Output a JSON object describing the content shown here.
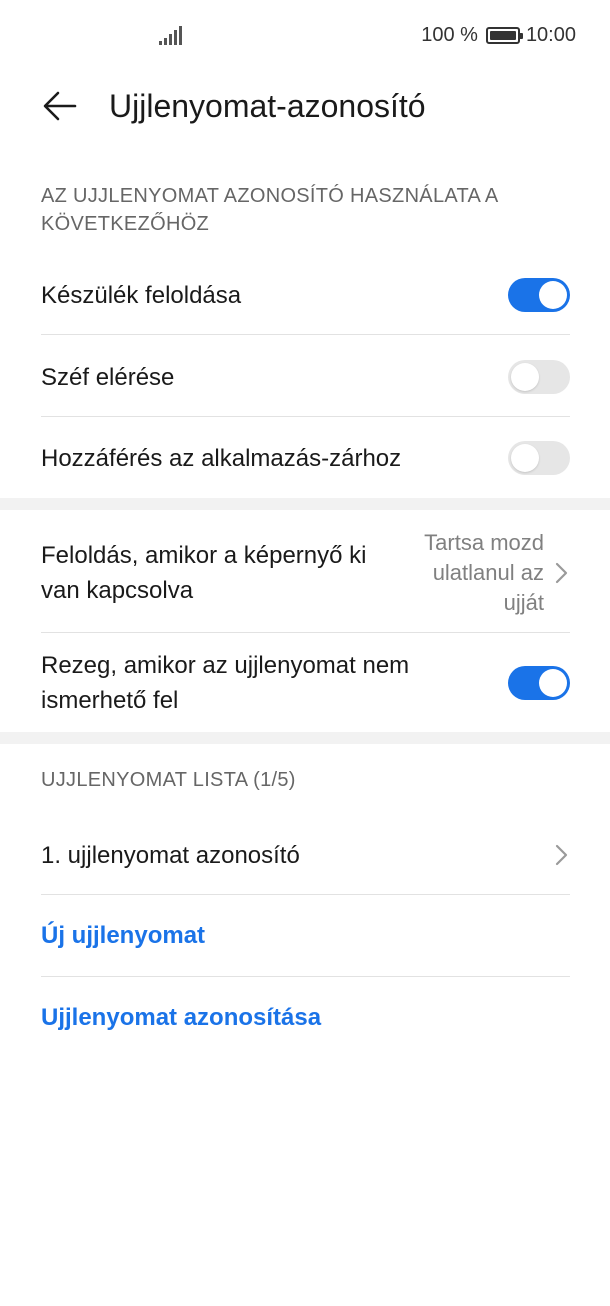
{
  "status_bar": {
    "battery_text": "100 %",
    "time": "10:00"
  },
  "app_bar": {
    "title": "Ujjlenyomat-azonosító"
  },
  "sections": {
    "usage_header": "AZ UJJLENYOMAT AZONOSÍTÓ HASZNÁLATA A KÖVETKEZŐHÖZ",
    "usage_items": [
      {
        "label": "Készülék feloldása",
        "enabled": true
      },
      {
        "label": "Széf elérése",
        "enabled": false
      },
      {
        "label": "Hozzáférés az alkalmazás-zárhoz",
        "enabled": false
      }
    ],
    "screen_off": {
      "label": "Feloldás, amikor a képernyő ki van kapcsolva",
      "value": "Tartsa mozd ulatlanul az ujját"
    },
    "vibrate": {
      "label": "Rezeg, amikor az ujjlenyomat nem ismerhető fel",
      "enabled": true
    },
    "list_header": "UJJLENYOMAT LISTA (1/5)",
    "list_items": [
      {
        "label": "1. ujjlenyomat azonosító"
      }
    ],
    "new_fingerprint": "Új ujjlenyomat",
    "identify_fingerprint": "Ujjlenyomat azonosítása"
  },
  "colors": {
    "accent": "#1a73e8",
    "toggle_off": "#e6e6e6"
  }
}
